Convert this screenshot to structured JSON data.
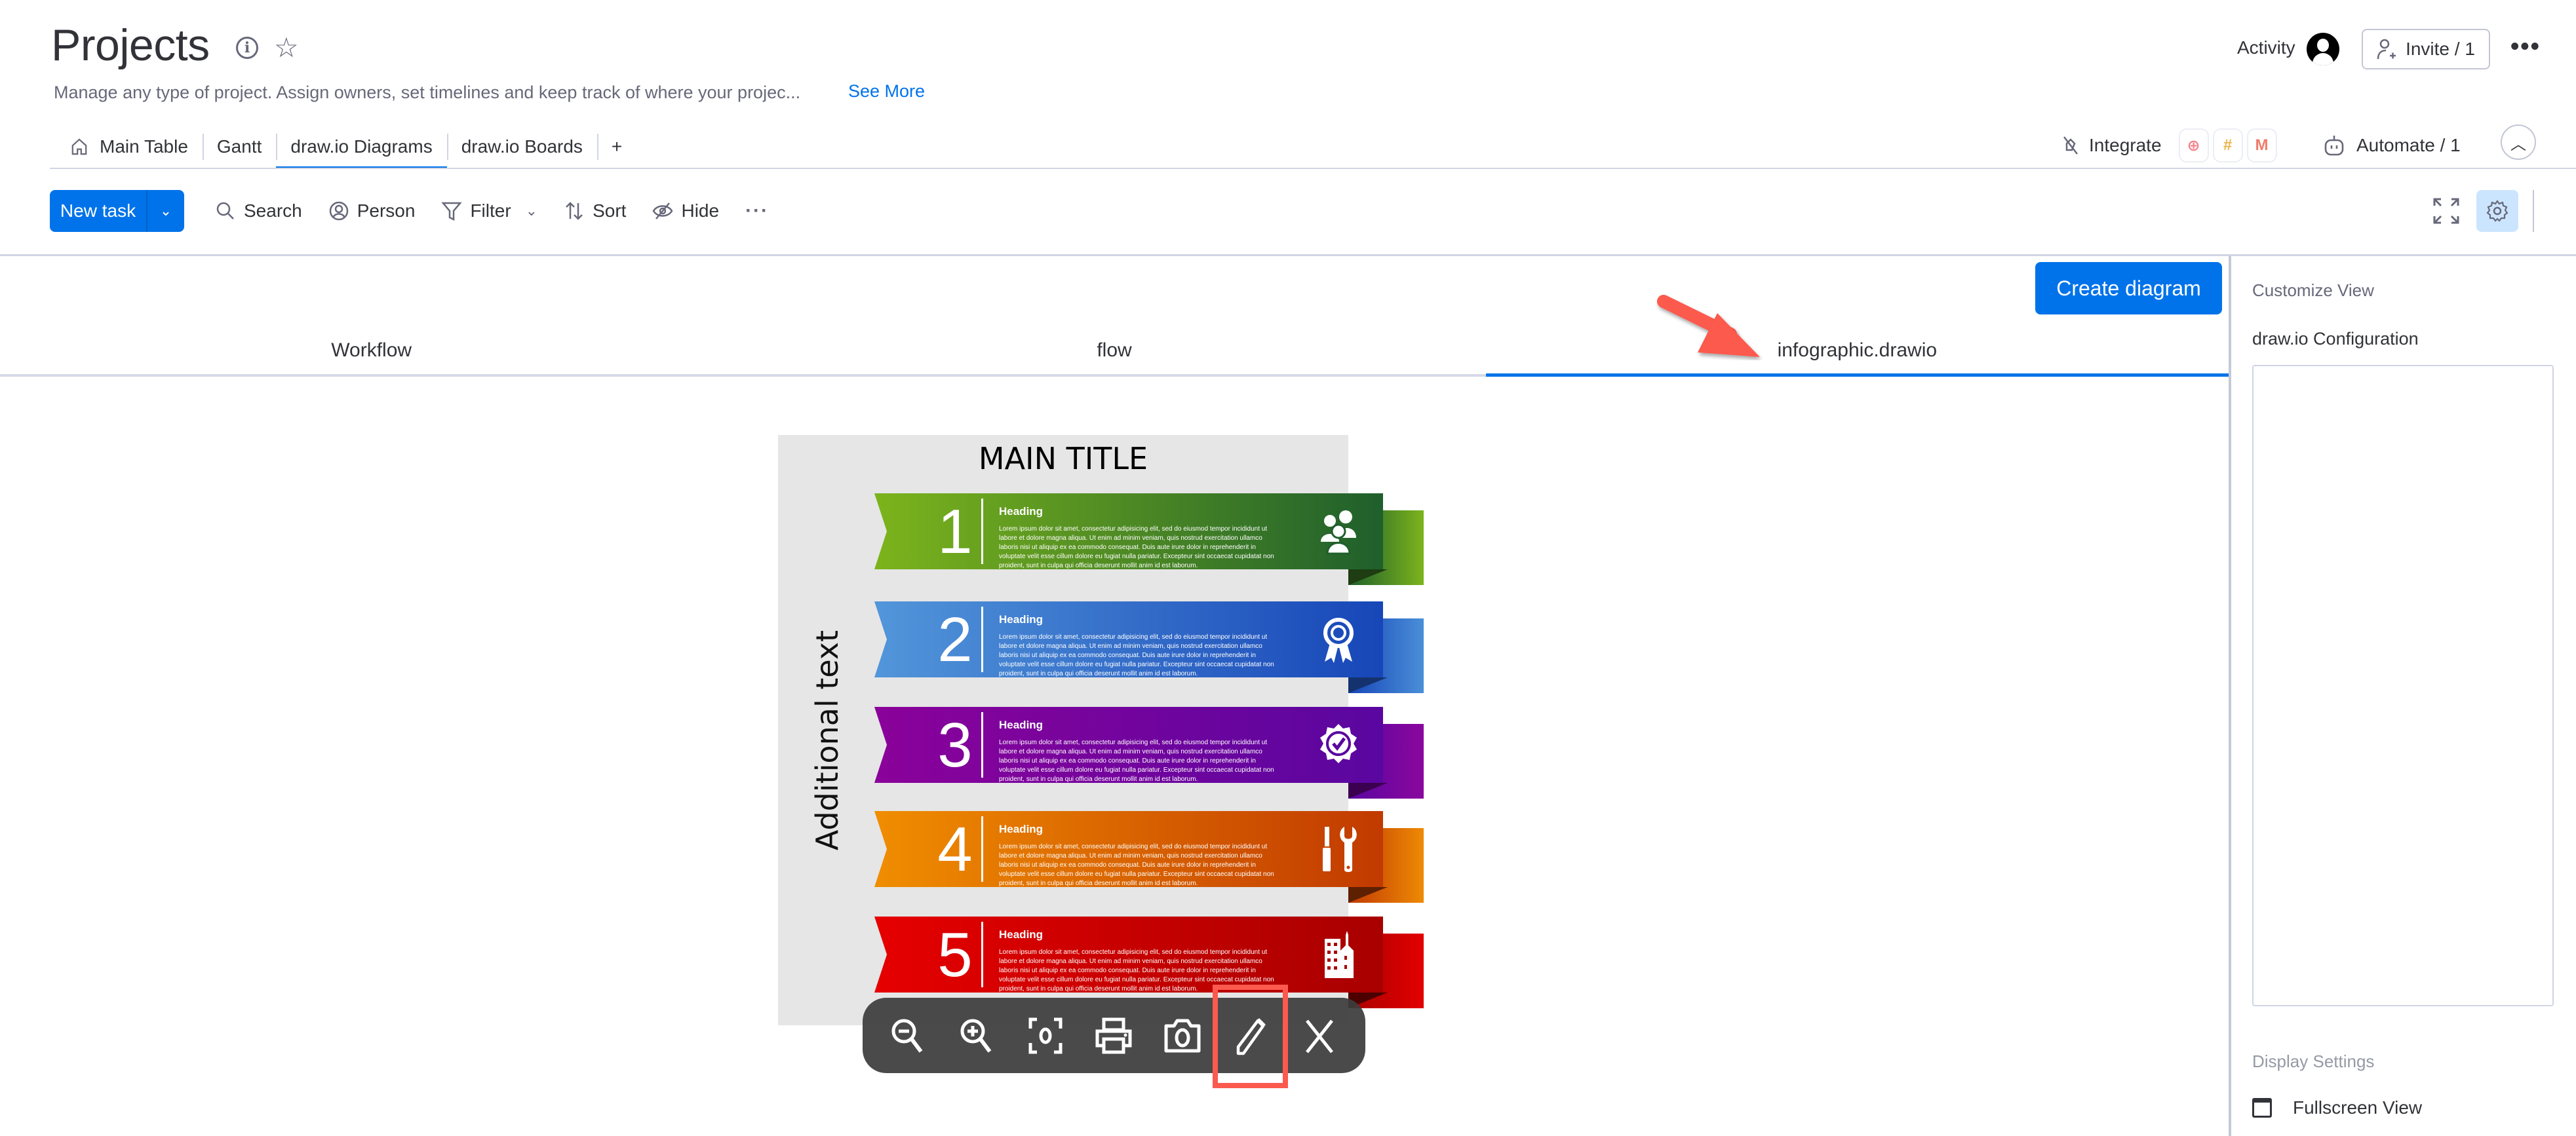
{
  "header": {
    "title": "Projects",
    "info_icon": "info-icon",
    "star_icon": "star-icon",
    "description": "Manage any type of project. Assign owners, set timelines and keep track of where your projec...",
    "see_more": "See More",
    "activity_label": "Activity",
    "invite_label": "Invite / 1",
    "more_icon": "more-horizontal-icon"
  },
  "board_tabs": [
    {
      "label": "Main Table",
      "icon": "home-icon",
      "active": false
    },
    {
      "label": "Gantt",
      "active": false
    },
    {
      "label": "draw.io Diagrams",
      "active": true
    },
    {
      "label": "draw.io Boards",
      "active": false
    },
    {
      "label": "+",
      "active": false
    }
  ],
  "integrations": {
    "label": "Integrate",
    "logos": [
      "twilio",
      "slack",
      "gmail"
    ],
    "automate_label": "Automate / 1"
  },
  "toolbar": {
    "new_task": "New task",
    "search": "Search",
    "person": "Person",
    "filter": "Filter",
    "sort": "Sort",
    "hide": "Hide",
    "more": "···"
  },
  "diagram_view": {
    "create_button": "Create diagram",
    "tabs": [
      {
        "label": "Workflow",
        "active": false
      },
      {
        "label": "flow",
        "active": false
      },
      {
        "label": "infographic.drawio",
        "active": true
      }
    ]
  },
  "infographic": {
    "main_title": "MAIN TITLE",
    "side_text": "Additional text",
    "items": [
      {
        "number": "1",
        "heading": "Heading",
        "icon": "people-icon",
        "color_start": "#7cb41c",
        "color_end": "#1f5f2c",
        "tab_color": "#7cb41c",
        "fold_color": "#1e3d12"
      },
      {
        "number": "2",
        "heading": "Heading",
        "icon": "award-ribbon-icon",
        "color_start": "#5296da",
        "color_end": "#1746b8",
        "tab_color": "#4a8fd8",
        "fold_color": "#14336e"
      },
      {
        "number": "3",
        "heading": "Heading",
        "icon": "verified-badge-icon",
        "color_start": "#8a029a",
        "color_end": "#5a06a0",
        "tab_color": "#8a079e",
        "fold_color": "#3b0050"
      },
      {
        "number": "4",
        "heading": "Heading",
        "icon": "tools-icon",
        "color_start": "#f08d00",
        "color_end": "#c13a00",
        "tab_color": "#ee8a05",
        "fold_color": "#5e2000"
      },
      {
        "number": "5",
        "heading": "Heading",
        "icon": "building-icon",
        "color_start": "#e60000",
        "color_end": "#a80000",
        "tab_color": "#e30000",
        "fold_color": "#4d0000"
      }
    ],
    "body_text": "Lorem ipsum dolor sit amet, consectetur adipisicing elit, sed do eiusmod tempor incididunt ut labore et dolore magna aliqua. Ut enim ad minim veniam, quis nostrud exercitation ullamco laboris nisi ut aliquip ex ea commodo consequat. Duis aute irure dolor in reprehenderit in voluptate velit esse cillum dolore eu fugiat nulla pariatur. Excepteur sint occaecat cupidatat non proident, sunt in culpa qui officia deserunt mollit anim id est laborum."
  },
  "viewer_toolbar": [
    {
      "name": "zoom-out",
      "icon": "zoom-out-icon"
    },
    {
      "name": "zoom-in",
      "icon": "zoom-in-icon"
    },
    {
      "name": "fit",
      "icon": "fit-view-icon"
    },
    {
      "name": "print",
      "icon": "print-icon"
    },
    {
      "name": "screenshot",
      "icon": "camera-icon"
    },
    {
      "name": "edit",
      "icon": "pencil-icon",
      "highlighted": true
    },
    {
      "name": "close",
      "icon": "close-icon"
    }
  ],
  "right_panel": {
    "title": "Customize View",
    "config_label": "draw.io Configuration",
    "config_value": "",
    "display_settings": "Display Settings",
    "fullscreen_label": "Fullscreen View",
    "fullscreen_checked": false
  },
  "colors": {
    "accent": "#0073ea",
    "annotation": "#fc5a4e",
    "settings_active_bg": "#cce5ff"
  }
}
